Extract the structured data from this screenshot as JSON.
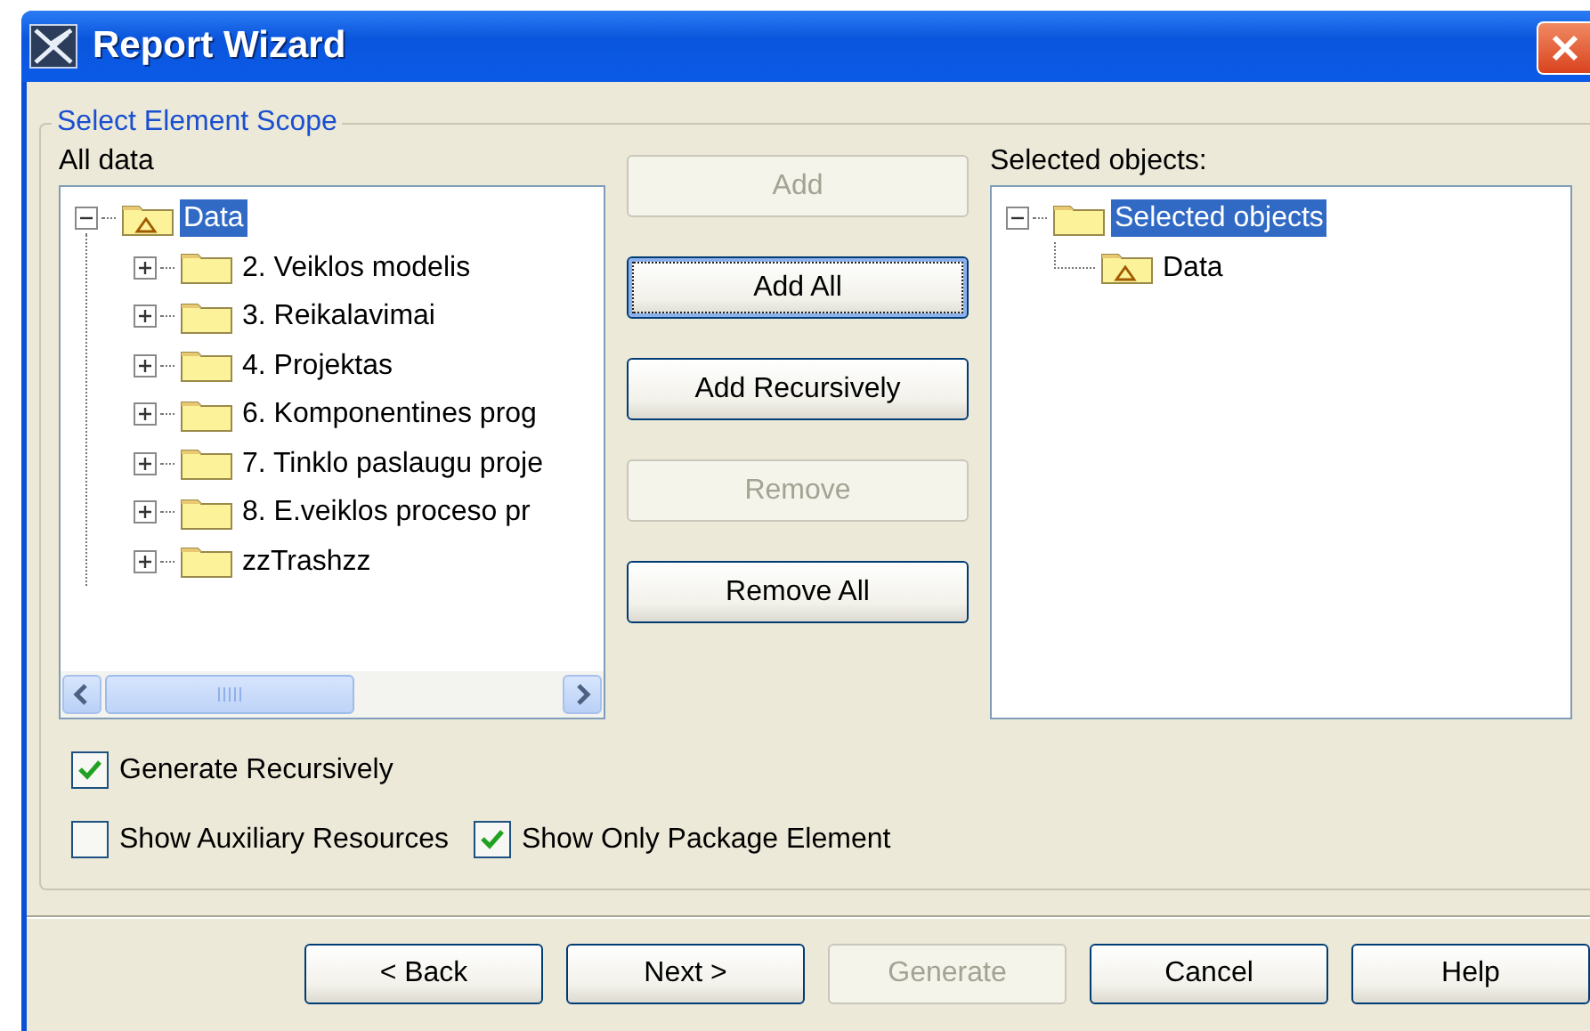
{
  "window": {
    "title": "Report Wizard"
  },
  "group": {
    "title": "Select Element Scope"
  },
  "left_tree": {
    "label": "All data",
    "nodes": [
      {
        "label": "Data",
        "kind": "model",
        "expanded": true,
        "selected": true,
        "children": [
          {
            "label": "2. Veiklos modelis",
            "kind": "package",
            "expanded": false,
            "selected": false
          },
          {
            "label": "3. Reikalavimai",
            "kind": "package",
            "expanded": false,
            "selected": false
          },
          {
            "label": "4. Projektas",
            "kind": "package",
            "expanded": false,
            "selected": false
          },
          {
            "label": "6. Komponentines prog",
            "kind": "package",
            "expanded": false,
            "selected": false
          },
          {
            "label": "7. Tinklo paslaugu proje",
            "kind": "package",
            "expanded": false,
            "selected": false
          },
          {
            "label": "8. E.veiklos proceso pr",
            "kind": "package",
            "expanded": false,
            "selected": false
          },
          {
            "label": "zzTrashzz",
            "kind": "package",
            "expanded": false,
            "selected": false
          }
        ]
      }
    ]
  },
  "move_buttons": [
    {
      "label": "Add",
      "disabled": true,
      "focused": false
    },
    {
      "label": "Add All",
      "disabled": false,
      "focused": true
    },
    {
      "label": "Add Recursively",
      "disabled": false,
      "focused": false
    },
    {
      "label": "Remove",
      "disabled": true,
      "focused": false
    },
    {
      "label": "Remove All",
      "disabled": false,
      "focused": false
    }
  ],
  "right_tree": {
    "label": "Selected objects:",
    "nodes": [
      {
        "label": "Selected objects",
        "kind": "package",
        "expanded": true,
        "selected": true,
        "children": [
          {
            "label": "Data",
            "kind": "model",
            "selected": false
          }
        ]
      }
    ]
  },
  "options": [
    [
      {
        "label": "Generate Recursively",
        "checked": true
      }
    ],
    [
      {
        "label": "Show Auxiliary Resources",
        "checked": false
      },
      {
        "label": "Show Only Package Element",
        "checked": true
      }
    ]
  ],
  "footer_buttons": [
    {
      "label": "< Back",
      "disabled": false
    },
    {
      "label": "Next >",
      "disabled": false
    },
    {
      "label": "Generate",
      "disabled": true
    },
    {
      "label": "Cancel",
      "disabled": false
    },
    {
      "label": "Help",
      "disabled": false
    }
  ]
}
